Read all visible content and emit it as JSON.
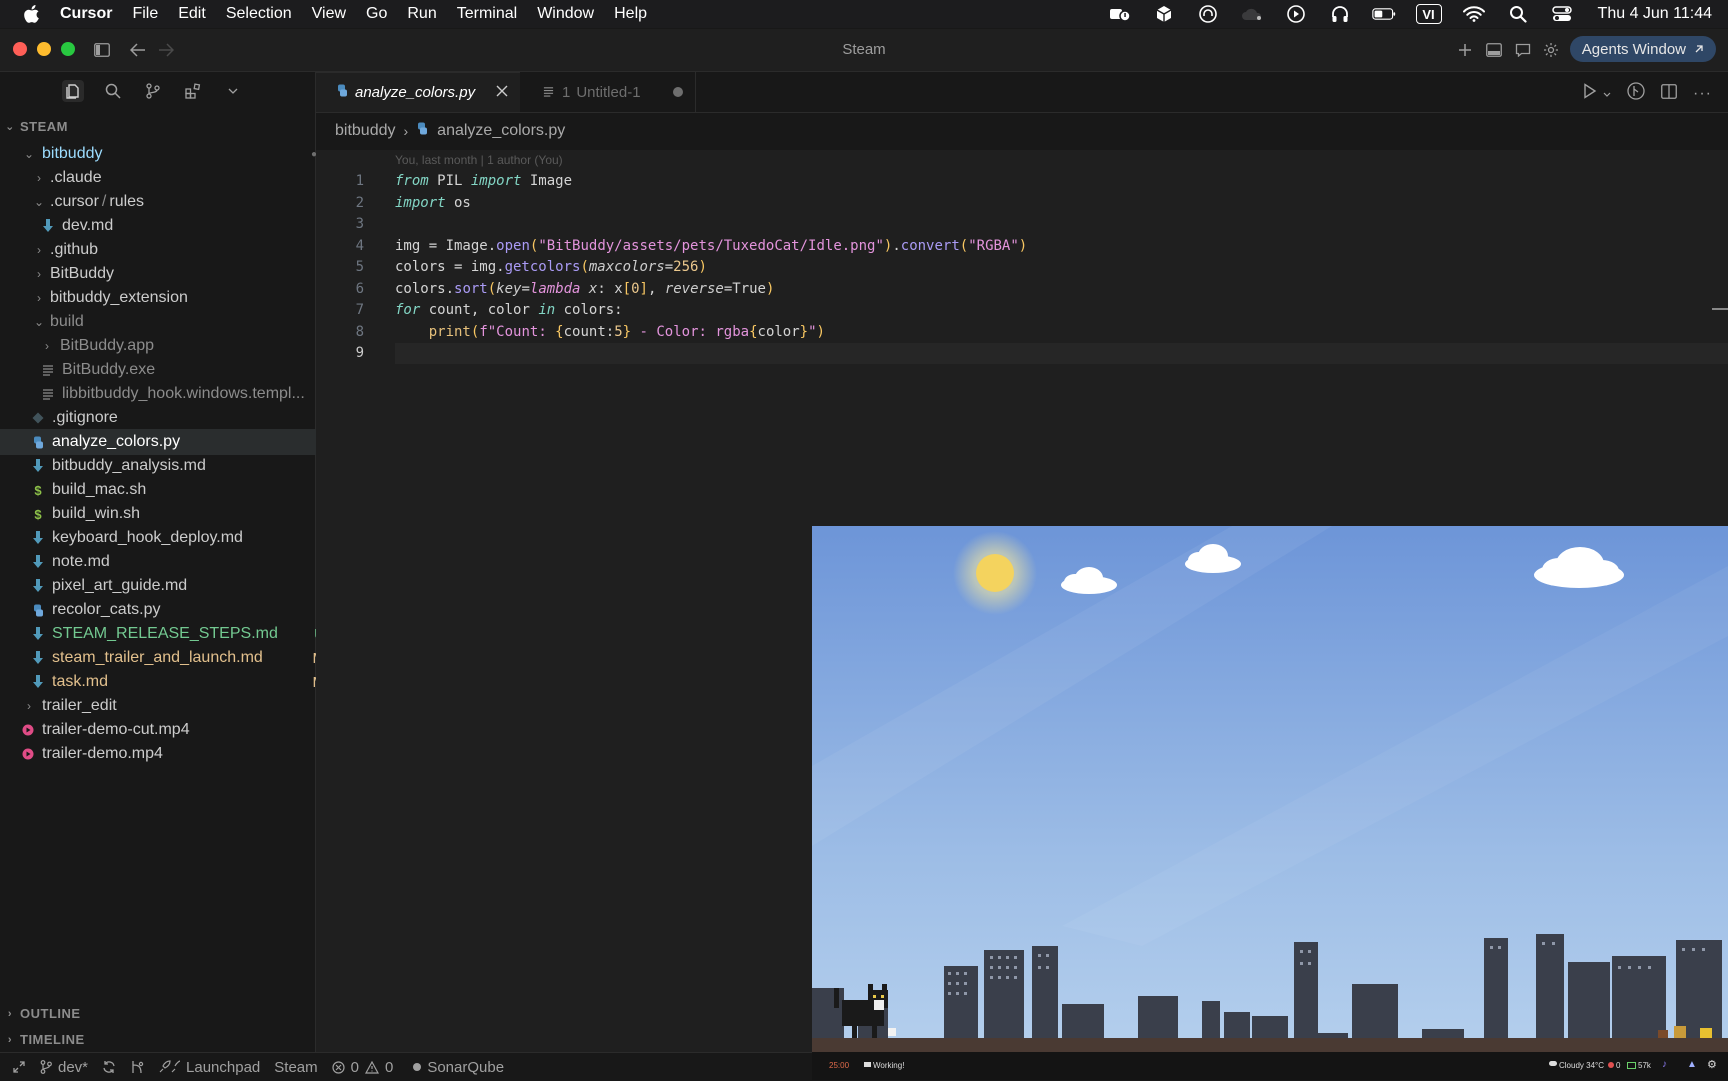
{
  "menubar": {
    "app_name": "Cursor",
    "items": [
      "File",
      "Edit",
      "Selection",
      "View",
      "Go",
      "Run",
      "Terminal",
      "Window",
      "Help"
    ],
    "input_source": "VI",
    "clock": "Thu 4 Jun  11:44"
  },
  "window": {
    "title": "Steam",
    "agents_button": "Agents Window"
  },
  "explorer": {
    "root": "STEAM",
    "items": [
      {
        "label": "bitbuddy",
        "badge": "●"
      },
      {
        "label": ".claude"
      },
      {
        "label": ".cursor",
        "label2": "rules"
      },
      {
        "label": "dev.md"
      },
      {
        "label": ".github"
      },
      {
        "label": "BitBuddy"
      },
      {
        "label": "bitbuddy_extension"
      },
      {
        "label": "build"
      },
      {
        "label": "BitBuddy.app"
      },
      {
        "label": "BitBuddy.exe"
      },
      {
        "label": "libbitbuddy_hook.windows.templ..."
      },
      {
        "label": ".gitignore"
      },
      {
        "label": "analyze_colors.py"
      },
      {
        "label": "bitbuddy_analysis.md"
      },
      {
        "label": "build_mac.sh"
      },
      {
        "label": "build_win.sh"
      },
      {
        "label": "keyboard_hook_deploy.md"
      },
      {
        "label": "note.md"
      },
      {
        "label": "pixel_art_guide.md"
      },
      {
        "label": "recolor_cats.py"
      },
      {
        "label": "STEAM_RELEASE_STEPS.md",
        "badge": "U"
      },
      {
        "label": "steam_trailer_and_launch.md",
        "badge": "M"
      },
      {
        "label": "task.md",
        "badge": "M"
      },
      {
        "label": "trailer_edit"
      },
      {
        "label": "trailer-demo-cut.mp4"
      },
      {
        "label": "trailer-demo.mp4"
      }
    ],
    "outline": "OUTLINE",
    "timeline": "TIMELINE"
  },
  "tabs": [
    {
      "label": "analyze_colors.py"
    },
    {
      "label": "Untitled-1",
      "prefix": "1"
    }
  ],
  "breadcrumb": {
    "folder": "bitbuddy",
    "file": "analyze_colors.py"
  },
  "editor": {
    "blame": "You, last month | 1 author (You)",
    "line_numbers": [
      "1",
      "2",
      "3",
      "4",
      "5",
      "6",
      "7",
      "8",
      "9"
    ]
  },
  "statusbar": {
    "branch": "dev*",
    "launchpad": "Launchpad",
    "workspace": "Steam",
    "errors": "0",
    "warnings": "0",
    "sonar": "SonarQube"
  },
  "game": {
    "timer": "25:00",
    "status": "Working!",
    "weather": "Cloudy 34°C",
    "coins": "0",
    "stat": "57k"
  },
  "colors": {
    "accent": "#2f4766",
    "untracked": "#73c991",
    "modified": "#e2c08d"
  }
}
